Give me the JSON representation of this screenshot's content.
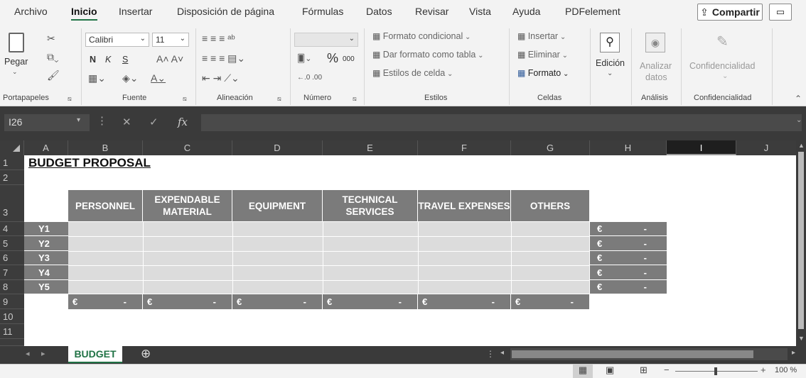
{
  "menu": {
    "items": [
      "Archivo",
      "Inicio",
      "Insertar",
      "Disposición de página",
      "Fórmulas",
      "Datos",
      "Revisar",
      "Vista",
      "Ayuda",
      "PDFelement"
    ],
    "active": "Inicio",
    "share_label": "Compartir"
  },
  "ribbon": {
    "clipboard": {
      "paste_label": "Pegar",
      "group_label": "Portapapeles"
    },
    "font": {
      "name": "Calibri",
      "size": "11",
      "bold": "N",
      "italic": "K",
      "underline": "S",
      "group_label": "Fuente"
    },
    "alignment": {
      "group_label": "Alineación"
    },
    "number": {
      "percent": "%",
      "thousands": "000",
      "group_label": "Número"
    },
    "styles": {
      "conditional_format": "Formato condicional",
      "format_as_table": "Dar formato como tabla",
      "cell_styles": "Estilos de celda",
      "group_label": "Estilos"
    },
    "cells": {
      "insert": "Insertar",
      "delete": "Eliminar",
      "format": "Formato",
      "group_label": "Celdas"
    },
    "editing": {
      "label": "Edición"
    },
    "analysis": {
      "label_1": "Analizar",
      "label_2": "datos",
      "group_label": "Análisis"
    },
    "confidentiality": {
      "label": "Confidencialidad",
      "group_label": "Confidencialidad"
    }
  },
  "formula_bar": {
    "name_box": "I26",
    "fx": "fx",
    "value": ""
  },
  "grid": {
    "columns": [
      "A",
      "B",
      "C",
      "D",
      "E",
      "F",
      "G",
      "H",
      "I",
      "J"
    ],
    "selected_column": "I",
    "rows": [
      "1",
      "2",
      "3",
      "4",
      "5",
      "6",
      "7",
      "8",
      "9",
      "10",
      "11"
    ],
    "title": "BUDGET PROPOSAL",
    "headers": {
      "personnel": "PERSONNEL",
      "expendable_1": "EXPENDABLE",
      "expendable_2": "MATERIAL",
      "equipment": "EQUIPMENT",
      "technical_1": "TECHNICAL",
      "technical_2": "SERVICES",
      "travel": "TRAVEL EXPENSES",
      "others": "OTHERS"
    },
    "years": [
      "Y1",
      "Y2",
      "Y3",
      "Y4",
      "Y5"
    ],
    "currency_symbol": "€",
    "empty_value": "-"
  },
  "sheets": {
    "active_tab": "BUDGET"
  },
  "status": {
    "zoom": "100 %"
  }
}
